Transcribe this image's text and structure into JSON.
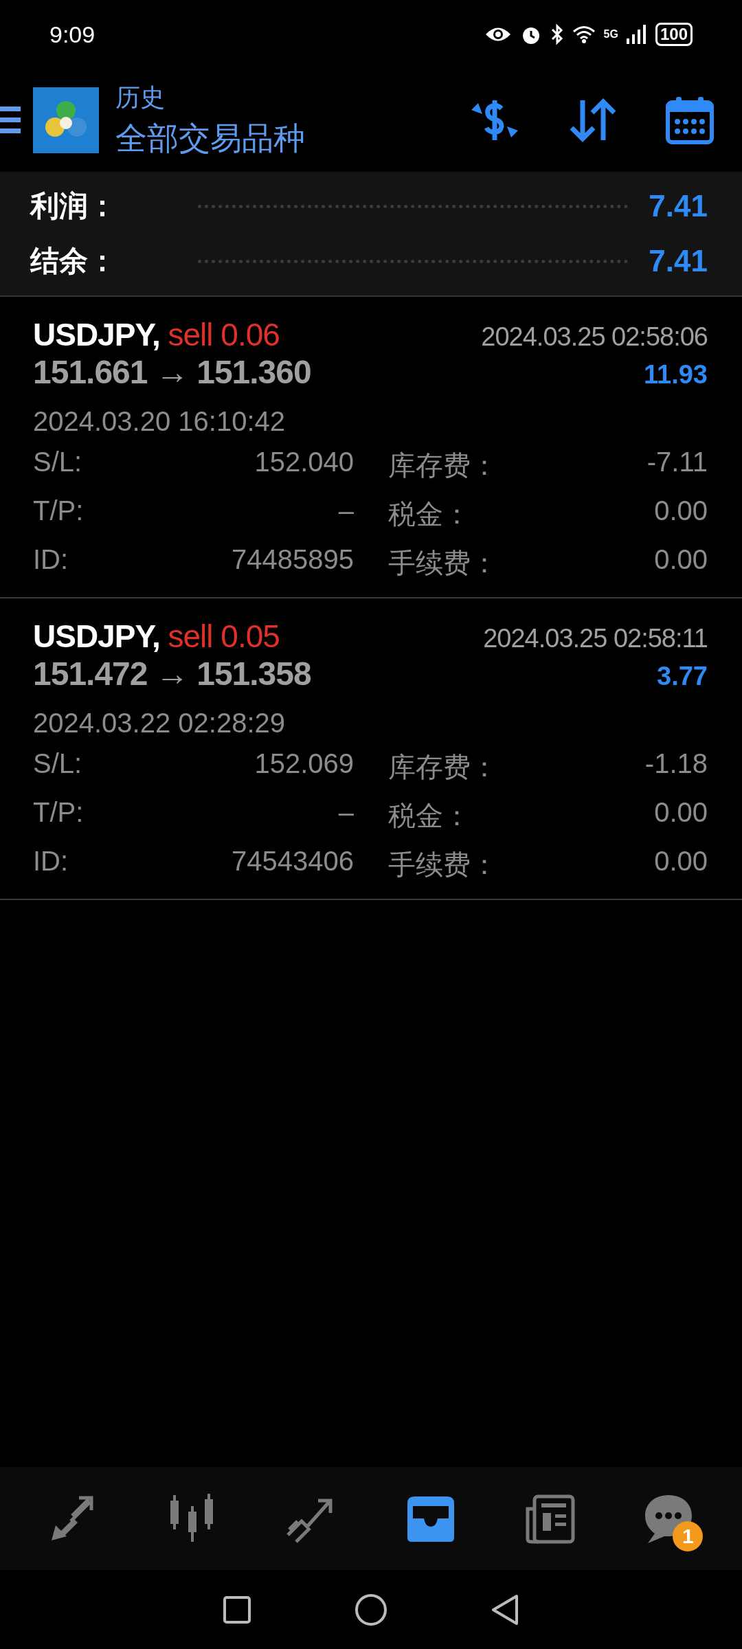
{
  "status_bar": {
    "time": "9:09",
    "network": "5G",
    "battery": "100"
  },
  "header": {
    "title": "历史",
    "subtitle": "全部交易品种"
  },
  "summary": [
    {
      "label": "利润：",
      "value": "7.41"
    },
    {
      "label": "结余：",
      "value": "7.41"
    }
  ],
  "deals": [
    {
      "symbol": "USDJPY,",
      "side": "sell 0.06",
      "open_price": "151.661",
      "close_price": "151.360",
      "arrow": "→",
      "close_time": "2024.03.25 02:58:06",
      "profit": "11.93",
      "open_time": "2024.03.20 16:10:42",
      "fields": [
        {
          "label": "S/L:",
          "value": "152.040"
        },
        {
          "label": "库存费：",
          "value": "-7.11"
        },
        {
          "label": "T/P:",
          "value": "–"
        },
        {
          "label": "税金：",
          "value": "0.00"
        },
        {
          "label": "ID:",
          "value": "74485895"
        },
        {
          "label": "手续费：",
          "value": "0.00"
        }
      ]
    },
    {
      "symbol": "USDJPY,",
      "side": "sell 0.05",
      "open_price": "151.472",
      "close_price": "151.358",
      "arrow": "→",
      "close_time": "2024.03.25 02:58:11",
      "profit": "3.77",
      "open_time": "2024.03.22 02:28:29",
      "fields": [
        {
          "label": "S/L:",
          "value": "152.069"
        },
        {
          "label": "库存费：",
          "value": "-1.18"
        },
        {
          "label": "T/P:",
          "value": "–"
        },
        {
          "label": "税金：",
          "value": "0.00"
        },
        {
          "label": "ID:",
          "value": "74543406"
        },
        {
          "label": "手续费：",
          "value": "0.00"
        }
      ]
    }
  ],
  "bottom_nav": [
    {
      "kind": "quotes",
      "selected": false
    },
    {
      "kind": "chart",
      "selected": false
    },
    {
      "kind": "trade",
      "selected": false
    },
    {
      "kind": "history",
      "selected": true
    },
    {
      "kind": "news",
      "selected": false
    },
    {
      "kind": "chat",
      "selected": false,
      "badge": "1"
    }
  ]
}
